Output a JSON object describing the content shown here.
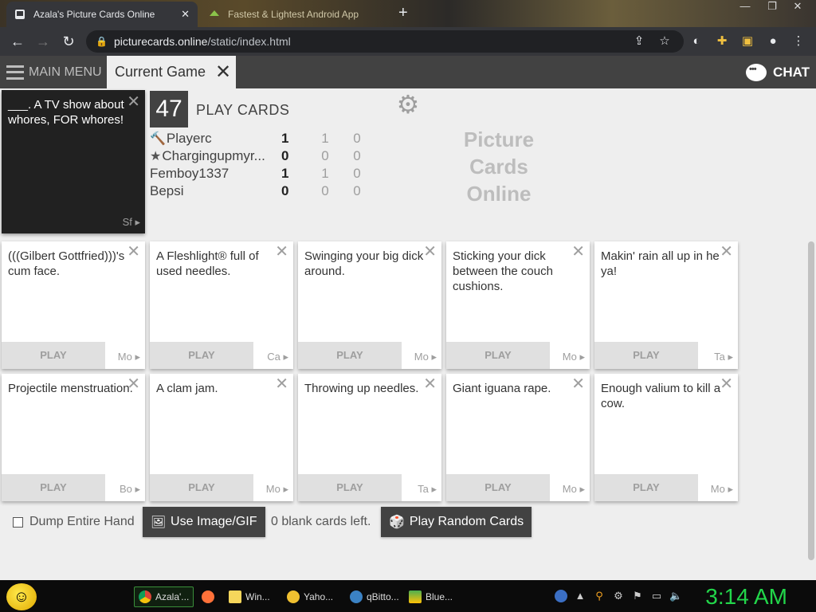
{
  "browser": {
    "tabs": [
      {
        "title": "Azala's Picture Cards Online",
        "active": true
      },
      {
        "title": "Fastest & Lightest Android App",
        "active": false
      }
    ],
    "url_host": "picturecards.online",
    "url_path": "/static/index.html"
  },
  "appbar": {
    "main_menu": "MAIN MENU",
    "current_tab": "Current Game",
    "chat": "CHAT"
  },
  "black_card": {
    "text": "___. A TV show about whores, FOR whores!",
    "source": "Sf"
  },
  "game": {
    "count": "47",
    "play_label": "PLAY CARDS",
    "logo": [
      "Picture",
      "Cards",
      "Online"
    ],
    "players": [
      {
        "icon": "gavel-icon",
        "name": "Playerc",
        "score": "1",
        "mid": "1",
        "last": "0"
      },
      {
        "icon": "star-icon",
        "name": "Chargingupmyr...",
        "score": "0",
        "mid": "0",
        "last": "0"
      },
      {
        "icon": "",
        "name": "Femboy1337",
        "score": "1",
        "mid": "1",
        "last": "0"
      },
      {
        "icon": "",
        "name": "Bepsi",
        "score": "0",
        "mid": "0",
        "last": "0"
      }
    ]
  },
  "hand": {
    "play_label": "PLAY",
    "cards": [
      {
        "text": "(((Gilbert Gottfried)))'s cum face.",
        "src": "Mo"
      },
      {
        "text": "A Fleshlight® full of used needles.",
        "src": "Ca"
      },
      {
        "text": "Swinging your big dick around.",
        "src": "Mo"
      },
      {
        "text": "Sticking your dick between the couch cushions.",
        "src": "Mo"
      },
      {
        "text": "Makin' rain all up in he ya!",
        "src": "Ta"
      },
      {
        "text": "Projectile menstruation.",
        "src": "Bo"
      },
      {
        "text": "A clam jam.",
        "src": "Mo"
      },
      {
        "text": "Throwing up needles.",
        "src": "Ta"
      },
      {
        "text": "Giant iguana rape.",
        "src": "Mo"
      },
      {
        "text": "Enough valium to kill a cow.",
        "src": "Mo"
      }
    ]
  },
  "controls": {
    "dump_label": "Dump Entire Hand",
    "image_btn": "Use Image/GIF",
    "blank_left": "0 blank cards left.",
    "random_btn": "Play Random Cards"
  },
  "taskbar": {
    "tasks": [
      "Azala'...",
      "",
      "Win...",
      "Yaho...",
      "qBitto...",
      "Blue..."
    ],
    "clock": "3:14 AM"
  },
  "colors": {
    "appbar": "#424242",
    "black_card": "#212121",
    "clock": "#22d64a"
  }
}
